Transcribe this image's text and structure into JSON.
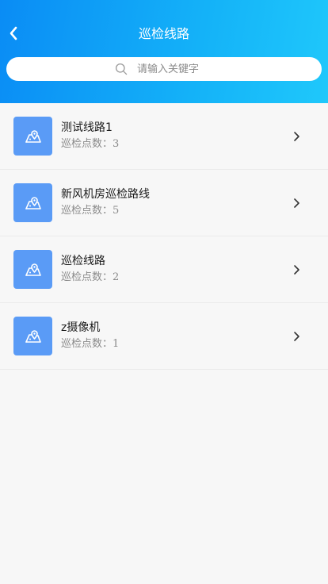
{
  "header": {
    "title": "巡检线路",
    "back_icon": "chevron-left-icon"
  },
  "search": {
    "placeholder": "请输入关键字",
    "icon": "search-icon"
  },
  "routes": [
    {
      "name": "测试线路1",
      "points_label": "巡检点数：",
      "points": "3"
    },
    {
      "name": "新风机房巡检路线",
      "points_label": "巡检点数：",
      "points": "5"
    },
    {
      "name": "巡检线路",
      "points_label": "巡检点数：",
      "points": "2"
    },
    {
      "name": "z摄像机",
      "points_label": "巡检点数：",
      "points": "1"
    }
  ],
  "colors": {
    "header_gradient_start": "#0a8cf5",
    "header_gradient_end": "#1fc8fb",
    "thumb_bg": "#5a9bf6",
    "background": "#f7f7f7"
  },
  "item_icon": "map-pin-icon",
  "item_arrow_icon": "chevron-right-icon"
}
